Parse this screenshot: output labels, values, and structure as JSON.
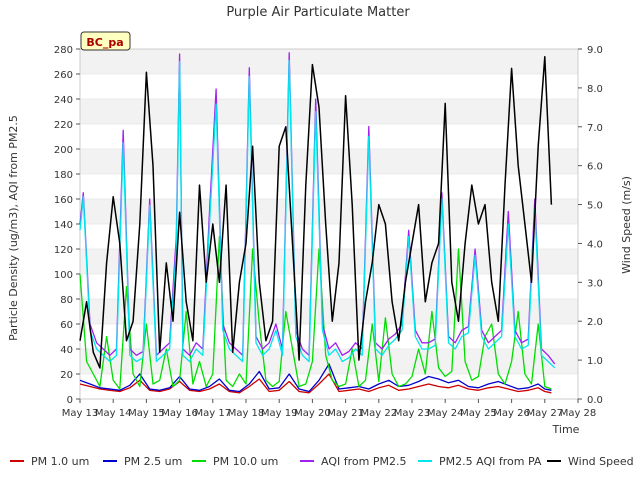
{
  "chart_data": {
    "type": "line",
    "title": "Purple Air Particulate Matter",
    "xlabel": "Time",
    "ylabel_left": "Particle Density (ug/m3), AQI from PM2.5",
    "ylabel_right": "Wind Speed (m/s)",
    "site_label": "BC_pa",
    "x_ticks": [
      "May 13",
      "May 14",
      "May 15",
      "May 16",
      "May 17",
      "May 18",
      "May 19",
      "May 20",
      "May 21",
      "May 22",
      "May 23",
      "May 24",
      "May 25",
      "May 26",
      "May 27",
      "May 28"
    ],
    "x_range_days": [
      13,
      28
    ],
    "y_left_range": [
      0,
      280
    ],
    "y_left_ticks": [
      "0",
      "20",
      "40",
      "60",
      "80",
      "100",
      "120",
      "140",
      "160",
      "180",
      "200",
      "220",
      "240",
      "260",
      "280"
    ],
    "y_right_range": [
      0.0,
      9.0
    ],
    "y_right_ticks": [
      "0.0",
      "1.0",
      "2.0",
      "3.0",
      "4.0",
      "5.0",
      "6.0",
      "7.0",
      "8.0",
      "9.0"
    ],
    "grid_bands": true,
    "legend_placement": "bottom",
    "series": [
      {
        "name": "PM 1.0 um",
        "color": "#cc0000",
        "axis": "left",
        "x": [
          13.0,
          13.3,
          13.6,
          13.9,
          14.2,
          14.5,
          14.8,
          15.1,
          15.4,
          15.7,
          16.0,
          16.3,
          16.6,
          16.9,
          17.2,
          17.5,
          17.8,
          18.1,
          18.4,
          18.7,
          19.0,
          19.3,
          19.6,
          19.9,
          20.2,
          20.5,
          20.8,
          21.1,
          21.4,
          21.7,
          22.0,
          22.3,
          22.6,
          22.9,
          23.2,
          23.5,
          23.8,
          24.1,
          24.4,
          24.7,
          25.0,
          25.3,
          25.6,
          25.9,
          26.2,
          26.5,
          26.8,
          27.0,
          27.2
        ],
        "values": [
          12,
          10,
          8,
          7,
          6,
          9,
          15,
          7,
          6,
          8,
          14,
          7,
          6,
          8,
          12,
          6,
          5,
          10,
          16,
          6,
          7,
          14,
          6,
          5,
          12,
          20,
          6,
          7,
          8,
          6,
          9,
          11,
          7,
          8,
          10,
          12,
          10,
          9,
          11,
          8,
          7,
          9,
          10,
          8,
          6,
          7,
          9,
          6,
          5
        ]
      },
      {
        "name": "PM 2.5 um",
        "color": "#0000cc",
        "axis": "left",
        "x": [
          13.0,
          13.3,
          13.6,
          13.9,
          14.2,
          14.5,
          14.8,
          15.1,
          15.4,
          15.7,
          16.0,
          16.3,
          16.6,
          16.9,
          17.2,
          17.5,
          17.8,
          18.1,
          18.4,
          18.7,
          19.0,
          19.3,
          19.6,
          19.9,
          20.2,
          20.5,
          20.8,
          21.1,
          21.4,
          21.7,
          22.0,
          22.3,
          22.6,
          22.9,
          23.2,
          23.5,
          23.8,
          24.1,
          24.4,
          24.7,
          25.0,
          25.3,
          25.6,
          25.9,
          26.2,
          26.5,
          26.8,
          27.0,
          27.2
        ],
        "values": [
          15,
          12,
          9,
          8,
          7,
          11,
          20,
          8,
          7,
          9,
          18,
          8,
          7,
          10,
          16,
          7,
          6,
          12,
          22,
          8,
          9,
          20,
          8,
          6,
          15,
          28,
          8,
          9,
          10,
          8,
          12,
          15,
          10,
          11,
          14,
          18,
          16,
          13,
          15,
          10,
          9,
          12,
          14,
          11,
          8,
          9,
          12,
          8,
          7
        ]
      },
      {
        "name": "PM 10.0 um",
        "color": "#00dd00",
        "axis": "left",
        "x": [
          13.0,
          13.2,
          13.4,
          13.6,
          13.8,
          14.0,
          14.2,
          14.4,
          14.6,
          14.8,
          15.0,
          15.2,
          15.4,
          15.6,
          15.8,
          16.0,
          16.2,
          16.4,
          16.6,
          16.8,
          17.0,
          17.2,
          17.4,
          17.6,
          17.8,
          18.0,
          18.2,
          18.4,
          18.6,
          18.8,
          19.0,
          19.2,
          19.4,
          19.6,
          19.8,
          20.0,
          20.2,
          20.4,
          20.6,
          20.8,
          21.0,
          21.2,
          21.4,
          21.6,
          21.8,
          22.0,
          22.2,
          22.4,
          22.6,
          22.8,
          23.0,
          23.2,
          23.4,
          23.6,
          23.8,
          24.0,
          24.2,
          24.4,
          24.6,
          24.8,
          25.0,
          25.2,
          25.4,
          25.6,
          25.8,
          26.0,
          26.2,
          26.4,
          26.6,
          26.8,
          27.0,
          27.2
        ],
        "values": [
          100,
          30,
          20,
          10,
          50,
          15,
          8,
          90,
          20,
          10,
          60,
          12,
          15,
          40,
          10,
          15,
          70,
          12,
          30,
          10,
          20,
          130,
          15,
          10,
          20,
          12,
          120,
          60,
          15,
          10,
          14,
          70,
          40,
          10,
          12,
          30,
          120,
          35,
          15,
          10,
          12,
          40,
          10,
          15,
          60,
          14,
          65,
          20,
          10,
          12,
          18,
          40,
          20,
          70,
          25,
          18,
          22,
          120,
          30,
          15,
          18,
          50,
          60,
          20,
          12,
          30,
          70,
          20,
          12,
          60,
          10,
          8
        ]
      },
      {
        "name": "AQI from PM2.5",
        "color": "#a020f0",
        "axis": "left",
        "x": [
          13.0,
          13.1,
          13.3,
          13.5,
          13.7,
          13.9,
          14.1,
          14.3,
          14.5,
          14.7,
          14.9,
          15.1,
          15.3,
          15.5,
          15.7,
          15.9,
          16.0,
          16.1,
          16.3,
          16.5,
          16.7,
          16.9,
          17.1,
          17.3,
          17.5,
          17.7,
          17.9,
          18.1,
          18.3,
          18.5,
          18.7,
          18.9,
          19.1,
          19.3,
          19.5,
          19.7,
          19.9,
          20.1,
          20.3,
          20.5,
          20.7,
          20.9,
          21.1,
          21.3,
          21.5,
          21.7,
          21.9,
          22.1,
          22.3,
          22.5,
          22.7,
          22.9,
          23.1,
          23.3,
          23.5,
          23.7,
          23.9,
          24.1,
          24.3,
          24.5,
          24.7,
          24.9,
          25.1,
          25.3,
          25.5,
          25.7,
          25.9,
          26.1,
          26.3,
          26.5,
          26.7,
          26.9,
          27.1,
          27.3
        ],
        "values": [
          140,
          165,
          60,
          45,
          40,
          35,
          40,
          215,
          40,
          35,
          38,
          160,
          35,
          40,
          45,
          130,
          276,
          40,
          35,
          45,
          40,
          150,
          248,
          60,
          45,
          40,
          35,
          265,
          50,
          40,
          45,
          60,
          40,
          277,
          55,
          40,
          35,
          240,
          60,
          40,
          45,
          35,
          38,
          45,
          40,
          218,
          45,
          40,
          48,
          52,
          60,
          135,
          55,
          45,
          45,
          48,
          165,
          50,
          45,
          55,
          58,
          120,
          55,
          45,
          50,
          55,
          150,
          55,
          45,
          48,
          160,
          40,
          35,
          28
        ]
      },
      {
        "name": "PM2.5 AQI from PA",
        "color": "#00e5ee",
        "axis": "left",
        "x": [
          13.0,
          13.1,
          13.3,
          13.5,
          13.7,
          13.9,
          14.1,
          14.3,
          14.5,
          14.7,
          14.9,
          15.1,
          15.3,
          15.5,
          15.7,
          15.9,
          16.0,
          16.1,
          16.3,
          16.5,
          16.7,
          16.9,
          17.1,
          17.3,
          17.5,
          17.7,
          17.9,
          18.1,
          18.3,
          18.5,
          18.7,
          18.9,
          19.1,
          19.3,
          19.5,
          19.7,
          19.9,
          20.1,
          20.3,
          20.5,
          20.7,
          20.9,
          21.1,
          21.3,
          21.5,
          21.7,
          21.9,
          22.1,
          22.3,
          22.5,
          22.7,
          22.9,
          23.1,
          23.3,
          23.5,
          23.7,
          23.9,
          24.1,
          24.3,
          24.5,
          24.7,
          24.9,
          25.1,
          25.3,
          25.5,
          25.7,
          25.9,
          26.1,
          26.3,
          26.5,
          26.7,
          26.9,
          27.1,
          27.3
        ],
        "values": [
          135,
          162,
          55,
          40,
          35,
          30,
          35,
          205,
          35,
          30,
          33,
          155,
          30,
          35,
          40,
          120,
          270,
          35,
          30,
          40,
          35,
          140,
          236,
          55,
          40,
          35,
          30,
          258,
          45,
          35,
          40,
          55,
          35,
          271,
          50,
          35,
          30,
          230,
          55,
          35,
          40,
          30,
          33,
          40,
          35,
          210,
          40,
          35,
          43,
          48,
          55,
          130,
          50,
          40,
          40,
          43,
          160,
          45,
          40,
          50,
          53,
          115,
          50,
          40,
          45,
          50,
          140,
          50,
          40,
          43,
          152,
          35,
          30,
          25
        ]
      },
      {
        "name": "Wind Speed",
        "color": "#000000",
        "axis": "right",
        "x": [
          13.0,
          13.2,
          13.4,
          13.6,
          13.8,
          14.0,
          14.2,
          14.4,
          14.6,
          14.8,
          15.0,
          15.2,
          15.4,
          15.6,
          15.8,
          16.0,
          16.2,
          16.4,
          16.6,
          16.8,
          17.0,
          17.2,
          17.4,
          17.6,
          17.8,
          18.0,
          18.2,
          18.4,
          18.6,
          18.8,
          19.0,
          19.2,
          19.4,
          19.6,
          19.8,
          20.0,
          20.2,
          20.4,
          20.6,
          20.8,
          21.0,
          21.2,
          21.4,
          21.6,
          21.8,
          22.0,
          22.2,
          22.4,
          22.6,
          22.8,
          23.0,
          23.2,
          23.4,
          23.6,
          23.8,
          24.0,
          24.2,
          24.4,
          24.6,
          24.8,
          25.0,
          25.2,
          25.4,
          25.6,
          25.8,
          26.0,
          26.2,
          26.4,
          26.6,
          26.8,
          27.0,
          27.2
        ],
        "values": [
          1.5,
          2.5,
          1.2,
          0.8,
          3.5,
          5.2,
          4.0,
          1.5,
          2.0,
          4.5,
          8.4,
          6.0,
          1.2,
          3.5,
          2.0,
          4.8,
          2.5,
          1.5,
          5.5,
          3.0,
          4.5,
          3.0,
          5.5,
          1.2,
          3.0,
          4.0,
          6.5,
          3.0,
          1.5,
          2.0,
          6.5,
          7.0,
          4.0,
          1.0,
          5.5,
          8.6,
          7.5,
          4.5,
          2.0,
          3.5,
          7.8,
          5.0,
          1.0,
          2.5,
          3.5,
          5.0,
          4.5,
          2.5,
          1.5,
          3.0,
          4.0,
          5.0,
          2.5,
          3.5,
          4.0,
          7.6,
          3.0,
          2.0,
          4.0,
          5.5,
          4.5,
          5.0,
          3.0,
          2.0,
          5.5,
          8.5,
          6.0,
          4.5,
          3.0,
          6.5,
          8.8,
          5.0
        ]
      }
    ]
  }
}
